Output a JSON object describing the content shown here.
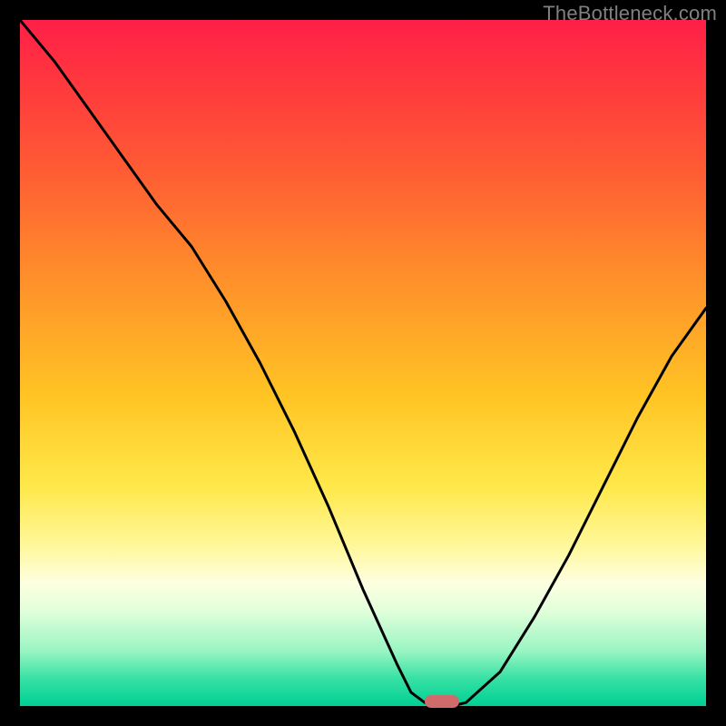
{
  "watermark": "TheBottleneck.com",
  "chart_data": {
    "type": "line",
    "title": "",
    "xlabel": "",
    "ylabel": "",
    "xlim": [
      0,
      100
    ],
    "ylim": [
      0,
      100
    ],
    "series": [
      {
        "name": "curve",
        "x": [
          0,
          5,
          10,
          15,
          20,
          25,
          30,
          35,
          40,
          45,
          50,
          55,
          57,
          59,
          61,
          63,
          65,
          70,
          75,
          80,
          85,
          90,
          95,
          100
        ],
        "y": [
          100,
          94,
          87,
          80,
          73,
          67,
          59,
          50,
          40,
          29,
          17,
          6,
          2,
          0.5,
          0,
          0,
          0.5,
          5,
          13,
          22,
          32,
          42,
          51,
          58
        ]
      }
    ],
    "marker": {
      "x": 61.5,
      "y": 0.7
    },
    "gradient_stops": [
      {
        "pct": 0,
        "color": "#ff1f47"
      },
      {
        "pct": 10,
        "color": "#ff3a3d"
      },
      {
        "pct": 22,
        "color": "#ff5c34"
      },
      {
        "pct": 36,
        "color": "#ff8a2b"
      },
      {
        "pct": 55,
        "color": "#ffc524"
      },
      {
        "pct": 68,
        "color": "#ffe84a"
      },
      {
        "pct": 77,
        "color": "#fff89e"
      },
      {
        "pct": 82,
        "color": "#fdffe0"
      },
      {
        "pct": 86,
        "color": "#e3ffdb"
      },
      {
        "pct": 92,
        "color": "#98f5c2"
      },
      {
        "pct": 96,
        "color": "#37e1a4"
      },
      {
        "pct": 100,
        "color": "#00cf94"
      }
    ]
  }
}
